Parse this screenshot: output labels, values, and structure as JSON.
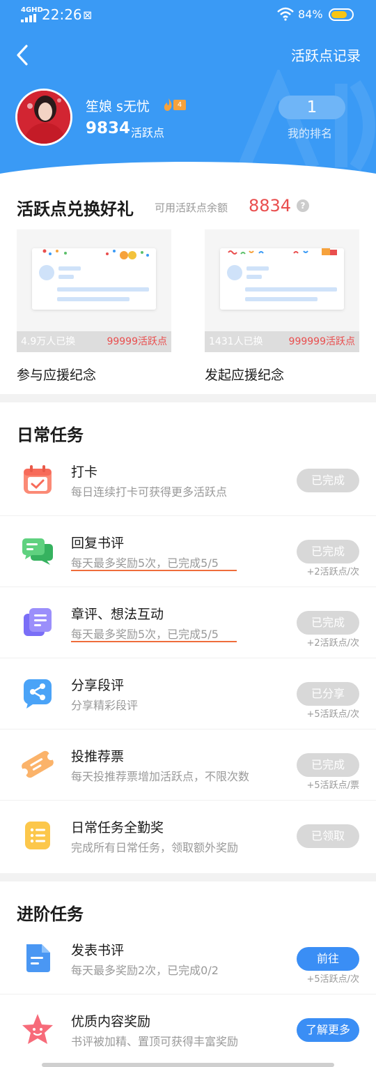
{
  "status_bar": {
    "signal_label": "4GHD",
    "time": "22:26",
    "battery": "84%"
  },
  "header": {
    "records_link": "活跃点记录",
    "user": {
      "name": "笙娘 s无忧",
      "level": "4",
      "points": "9834",
      "points_label": "活跃点"
    },
    "rank": {
      "value": "1",
      "label": "我的排名"
    }
  },
  "exchange": {
    "title": "活跃点兑换好礼",
    "balance_label": "可用活跃点余额",
    "balance": "8834",
    "help_icon": "question-icon",
    "items": [
      {
        "label": "参与应援纪念",
        "count": "4.9万人已换",
        "cost": "99999活跃点"
      },
      {
        "label": "发起应援纪念",
        "count": "1431人已换",
        "cost": "999999活跃点"
      }
    ]
  },
  "daily": {
    "title": "日常任务",
    "tasks": [
      {
        "name": "打卡",
        "desc": "每日连续打卡可获得更多活跃点",
        "button": "已完成",
        "reward": "",
        "icon": "calendar-check-icon"
      },
      {
        "name": "回复书评",
        "desc": "每天最多奖励5次，已完成5/5",
        "button": "已完成",
        "reward": "+2活跃点/次",
        "icon": "chat-bubbles-icon"
      },
      {
        "name": "章评、想法互动",
        "desc": "每天最多奖励5次，已完成5/5",
        "button": "已完成",
        "reward": "+2活跃点/次",
        "icon": "note-stack-icon"
      },
      {
        "name": "分享段评",
        "desc": "分享精彩段评",
        "button": "已分享",
        "reward": "+5活跃点/次",
        "icon": "share-icon"
      },
      {
        "name": "投推荐票",
        "desc": "每天投推荐票增加活跃点，不限次数",
        "button": "已完成",
        "reward": "+5活跃点/票",
        "icon": "ticket-icon"
      },
      {
        "name": "日常任务全勤奖",
        "desc": "完成所有日常任务，领取额外奖励",
        "button": "已领取",
        "reward": "",
        "icon": "list-icon"
      }
    ]
  },
  "advanced": {
    "title": "进阶任务",
    "tasks": [
      {
        "name": "发表书评",
        "desc": "每天最多奖励2次，已完成0/2",
        "button": "前往",
        "reward": "+5活跃点/次",
        "icon": "document-icon"
      },
      {
        "name": "优质内容奖励",
        "desc": "书评被加精、置顶可获得丰富奖励",
        "button": "了解更多",
        "reward": "",
        "icon": "star-icon"
      }
    ]
  },
  "colors": {
    "header_blue": "#3a9af5",
    "accent_red": "#e94e4e",
    "done_gray": "#d8d8d8",
    "action_blue": "#3a8ef5"
  }
}
